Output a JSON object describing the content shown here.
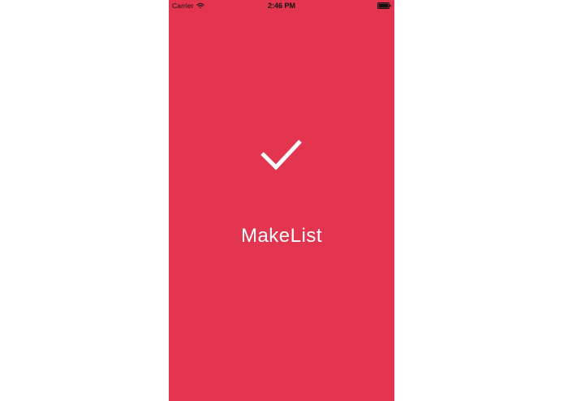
{
  "status_bar": {
    "carrier": "Carrier",
    "time": "2:46 PM",
    "wifi_icon": "wifi-icon",
    "battery_icon": "battery-icon",
    "text_color": "#111111"
  },
  "splash": {
    "background_color": "#e3354f",
    "logo_icon": "checkmark-icon",
    "logo_color": "#ffffff",
    "title": "MakeList"
  }
}
